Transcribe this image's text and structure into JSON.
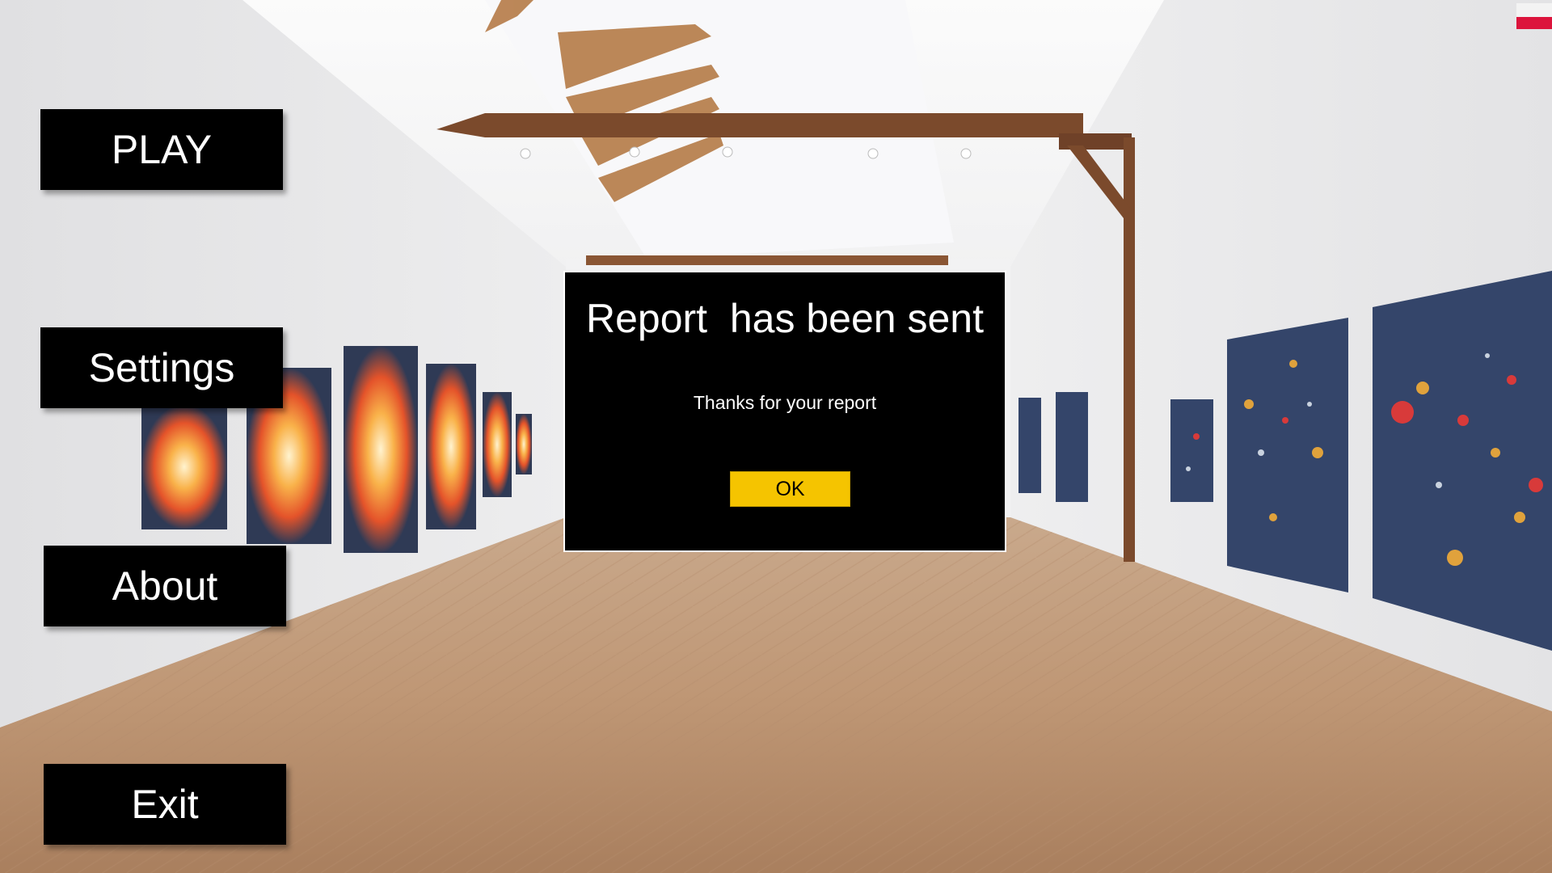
{
  "menu": {
    "play_label": "PLAY",
    "settings_label": "Settings",
    "about_label": "About",
    "exit_label": "Exit"
  },
  "dialog": {
    "title": "Report  has been sent",
    "message": "Thanks for your report",
    "ok_label": "OK"
  },
  "language": {
    "flag_icon": "poland-flag-icon",
    "colors": [
      "#f3f3f3",
      "#dc143c"
    ]
  },
  "colors": {
    "button_bg": "#000000",
    "button_text": "#ffffff",
    "ok_button_bg": "#f5c400"
  }
}
